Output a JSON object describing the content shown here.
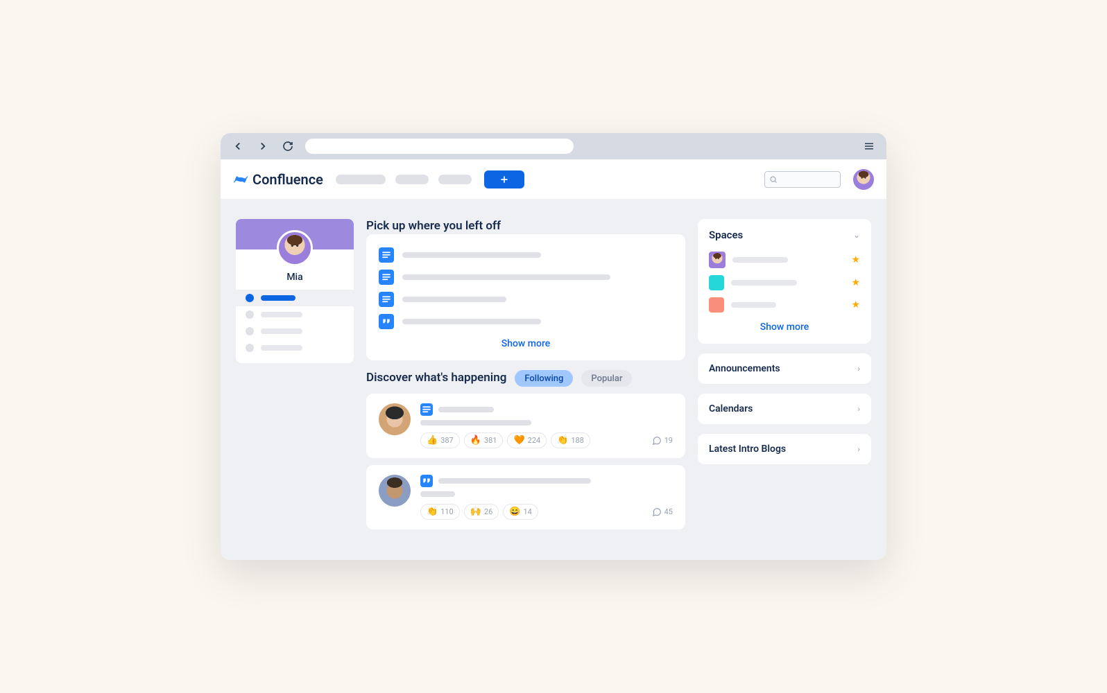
{
  "app": {
    "name": "Confluence"
  },
  "profile": {
    "name": "Mia"
  },
  "sections": {
    "pickup_title": "Pick up where you left off",
    "pickup_show_more": "Show more",
    "discover_title": "Discover what's happening"
  },
  "filters": {
    "following": "Following",
    "popular": "Popular"
  },
  "feed": [
    {
      "reactions": [
        {
          "emoji": "👍",
          "count": "387"
        },
        {
          "emoji": "🔥",
          "count": "381"
        },
        {
          "emoji": "🧡",
          "count": "224"
        },
        {
          "emoji": "👏",
          "count": "188"
        }
      ],
      "comments": "19"
    },
    {
      "reactions": [
        {
          "emoji": "👏",
          "count": "110"
        },
        {
          "emoji": "🙌",
          "count": "26"
        },
        {
          "emoji": "😄",
          "count": "14"
        }
      ],
      "comments": "45"
    }
  ],
  "spaces": {
    "title": "Spaces",
    "show_more": "Show more",
    "items": [
      {
        "color": "avatar"
      },
      {
        "color": "#26d7d9"
      },
      {
        "color": "#f98e7a"
      }
    ]
  },
  "sidebar_links": {
    "announcements": "Announcements",
    "calendars": "Calendars",
    "latest_blogs": "Latest Intro Blogs"
  }
}
